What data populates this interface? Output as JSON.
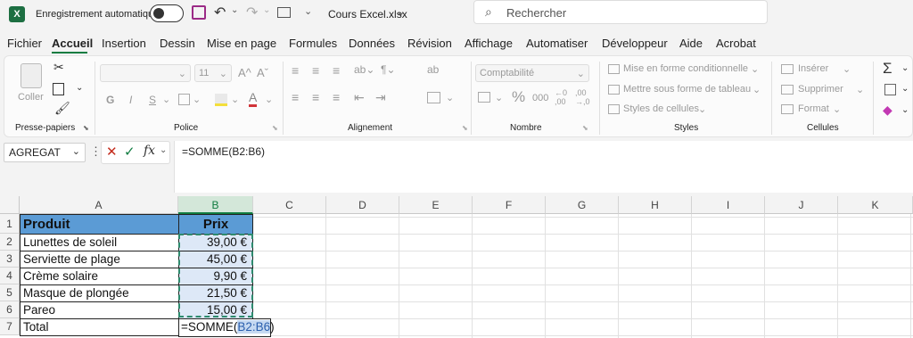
{
  "titlebar": {
    "app_icon": "X",
    "autosave_label": "Enregistrement automatique",
    "file_name": "Cours Excel.xlsx",
    "search_placeholder": "Rechercher"
  },
  "menu": [
    "Fichier",
    "Accueil",
    "Insertion",
    "Dessin",
    "Mise en page",
    "Formules",
    "Données",
    "Révision",
    "Affichage",
    "Automatiser",
    "Développeur",
    "Aide",
    "Acrobat"
  ],
  "active_tab": "Accueil",
  "ribbon": {
    "clipboard": {
      "paste": "Coller",
      "group": "Presse-papiers"
    },
    "font": {
      "font_size": "11",
      "bold": "G",
      "italic": "I",
      "underline": "S",
      "group": "Police"
    },
    "alignment": {
      "wrap": "ab",
      "group": "Alignement"
    },
    "number": {
      "format": "Comptabilité",
      "percent": "%",
      "thousands": "000",
      "group": "Nombre"
    },
    "styles": {
      "conditional": "Mise en forme conditionnelle",
      "table": "Mettre sous forme de tableau",
      "cell_styles": "Styles de cellules",
      "group": "Styles"
    },
    "cells": {
      "insert": "Insérer",
      "delete": "Supprimer",
      "format": "Format",
      "group": "Cellules"
    }
  },
  "formula_bar": {
    "name_box": "AGREGAT",
    "formula": "=SOMME(B2:B6)",
    "fx": "fx"
  },
  "sheet": {
    "columns": [
      "A",
      "B",
      "C",
      "D",
      "E",
      "F",
      "G",
      "H",
      "I",
      "J",
      "K"
    ],
    "rows": [
      "1",
      "2",
      "3",
      "4",
      "5",
      "6",
      "7"
    ],
    "header": {
      "a": "Produit",
      "b": "Prix"
    },
    "items": [
      {
        "name": "Lunettes de soleil",
        "price": "39,00 €"
      },
      {
        "name": "Serviette de plage",
        "price": "45,00 €"
      },
      {
        "name": "Crème solaire",
        "price": "9,90 €"
      },
      {
        "name": "Masque de plongée",
        "price": "21,50 €"
      },
      {
        "name": "Pareo",
        "price": "15,00 €"
      }
    ],
    "total_label": "Total",
    "edit_prefix": "=SOMME(",
    "edit_ref": "B2:B6",
    "edit_suffix": ")"
  },
  "colors": {
    "accent": "#107c41",
    "header_fill": "#5b9bd5",
    "selection": "#dde8f7"
  }
}
